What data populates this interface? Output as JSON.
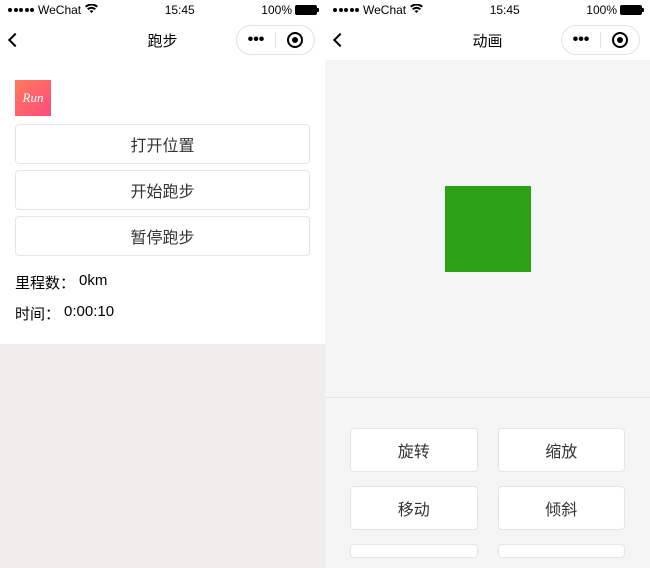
{
  "status": {
    "carrier": "WeChat",
    "time": "15:45",
    "battery_pct": "100%"
  },
  "left": {
    "title": "跑步",
    "logo_text": "Run",
    "buttons": {
      "open_location": "打开位置",
      "start_run": "开始跑步",
      "pause_run": "暂停跑步"
    },
    "stats": {
      "distance_label": "里程数：",
      "distance_value": "0km",
      "time_label": "时间：",
      "time_value": "0:00:10"
    }
  },
  "right": {
    "title": "动画",
    "buttons": {
      "rotate": "旋转",
      "scale": "缩放",
      "move": "移动",
      "skew": "倾斜"
    }
  }
}
